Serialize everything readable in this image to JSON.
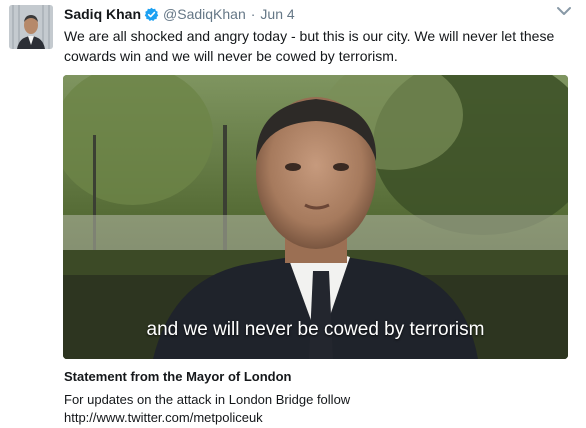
{
  "tweet": {
    "author_name": "Sadiq Khan",
    "handle": "@SadiqKhan",
    "separator": "·",
    "time": "Jun 4",
    "text": "We are all shocked and angry today - but this is our city. We will never let these cowards win and we will never be cowed by terrorism.",
    "icons": {
      "verified": "verified-badge-icon",
      "menu": "chevron-down-icon"
    },
    "colors": {
      "verified": "#1da1f2",
      "muted": "#657786",
      "text": "#14171a"
    }
  },
  "media": {
    "caption": "and we will never be cowed by terrorism"
  },
  "card": {
    "title": "Statement from the Mayor of London",
    "description_line1": "For updates on the attack in London Bridge follow",
    "description_line2": "http://www.twitter.com/metpoliceuk"
  }
}
